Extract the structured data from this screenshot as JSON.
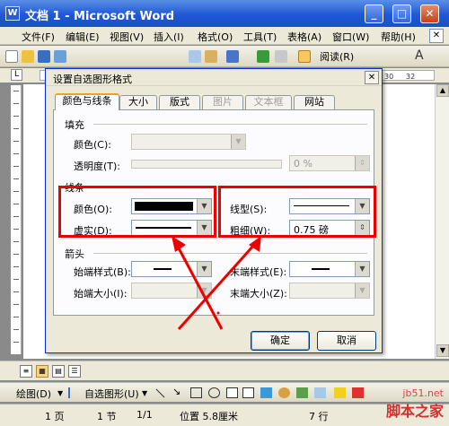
{
  "window": {
    "title": "文档 1 - Microsoft Word",
    "app_icon": "W"
  },
  "window_buttons": {
    "minimize": "_",
    "maximize": "□",
    "close": "✕"
  },
  "menu": [
    "文件(F)",
    "编辑(E)",
    "视图(V)",
    "插入(I)",
    "格式(O)",
    "工具(T)",
    "表格(A)",
    "窗口(W)",
    "帮助(H)"
  ],
  "menu_close": "✕",
  "toolbar": {
    "reading_label": "阅读(R)",
    "font_glyph": "A"
  },
  "ruler": {
    "tab_marker": "L",
    "numbers": [
      "30",
      "32"
    ]
  },
  "dialog": {
    "title": "设置自选图形格式",
    "close": "✕",
    "tabs": [
      {
        "label": "颜色与线条",
        "state": "active"
      },
      {
        "label": "大小",
        "state": "normal"
      },
      {
        "label": "版式",
        "state": "normal"
      },
      {
        "label": "图片",
        "state": "disabled"
      },
      {
        "label": "文本框",
        "state": "disabled"
      },
      {
        "label": "网站",
        "state": "normal"
      }
    ],
    "fill": {
      "section": "填充",
      "color_label": "颜色(C):",
      "transparency_label": "透明度(T):",
      "transparency_value": "0 %"
    },
    "line": {
      "section": "线条",
      "color_label": "颜色(O):",
      "color_value": "#000000",
      "dash_label": "虚实(D):",
      "style_label": "线型(S):",
      "weight_label": "粗细(W):",
      "weight_value": "0.75 磅"
    },
    "arrows": {
      "section": "箭头",
      "begin_style_label": "始端样式(B):",
      "begin_size_label": "始端大小(I):",
      "end_style_label": "末端样式(E):",
      "end_size_label": "末端大小(Z):"
    },
    "ok_label": "确定",
    "cancel_label": "取消"
  },
  "drawbar": {
    "draw_label": "绘图(D)",
    "autoshape_label": "自选图形(U)"
  },
  "status": [
    "1 页",
    "1 节",
    "1/1",
    "位置 5.8厘米",
    "7 行"
  ],
  "watermark": {
    "site": "jb51.net",
    "name": "脚本之家"
  },
  "colors": {
    "title_bar": "#1f57d6",
    "highlight": "#ee0000",
    "tab_accent": "#f0a020"
  }
}
